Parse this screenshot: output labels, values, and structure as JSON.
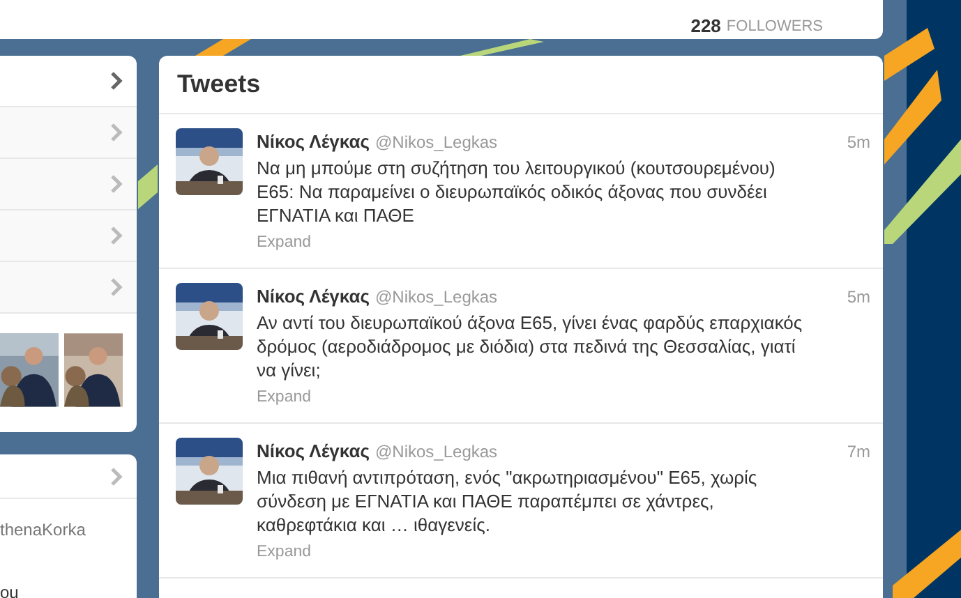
{
  "profile_card": {
    "followers_count": "228",
    "followers_label": "FOLLOWERS"
  },
  "left_panel": {
    "rows": [
      {
        "kind": "chevron"
      },
      {
        "kind": "chevron"
      },
      {
        "kind": "chevron"
      },
      {
        "kind": "chevron"
      },
      {
        "kind": "chevron"
      }
    ]
  },
  "left_panel_2": {
    "texts": [
      "thenaKorka",
      "ou"
    ]
  },
  "tweets_panel": {
    "title": "Tweets",
    "tweets": [
      {
        "name": "Νίκος Λέγκας",
        "handle": "@Nikos_Legkas",
        "time": "5m",
        "text": "Να μη μπούμε στη συζήτηση του λειτουργικού (κουτσουρεμένου)\nΕ65: Να παραμείνει ο διευρωπαϊκός οδικός άξονας που συνδέει\nΕΓΝΑΤΙΑ και ΠΑΘΕ",
        "action": "Expand"
      },
      {
        "name": "Νίκος Λέγκας",
        "handle": "@Nikos_Legkas",
        "time": "5m",
        "text": "Αν αντί του διευρωπαϊκού άξονα Ε65, γίνει ένας φαρδύς επαρχιακός\nδρόμος (αεροδιάδρομος με διόδια) στα πεδινά της Θεσσαλίας, γιατί\nνα γίνει;",
        "action": "Expand"
      },
      {
        "name": "Νίκος Λέγκας",
        "handle": "@Nikos_Legkas",
        "time": "7m",
        "text": "Μια πιθανή αντιπρόταση, ενός \"ακρωτηριασμένου\" Ε65, χωρίς\nσύνδεση με ΕΓΝΑΤΙΑ και ΠΑΘΕ παραπέμπει σε χάντρες,\nκαθρεφτάκια και … ιθαγενείς.",
        "action": "Expand"
      }
    ]
  }
}
